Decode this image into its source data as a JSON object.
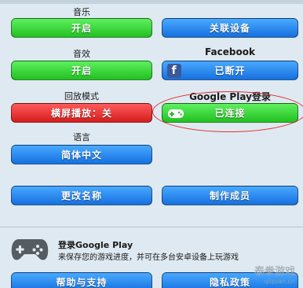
{
  "settings": {
    "music_label": "音乐",
    "music_button": "开启",
    "link_device_button": "关联设备",
    "sfx_label": "音效",
    "sfx_button": "开启",
    "facebook_label": "Facebook",
    "facebook_button": "已断开",
    "replay_label": "回放模式",
    "replay_button": "横屏播放：关",
    "gplay_label": "Google Play登录",
    "gplay_button": "已连接",
    "language_label": "语言",
    "language_button": "简体中文",
    "rename_button": "更改名称",
    "credits_button": "制作成员",
    "help_button": "帮助与支持",
    "privacy_button": "隐私政策"
  },
  "info": {
    "title": "登录Google Play",
    "desc": "来保存您的游戏进度，并可在多台安卓设备上玩游戏"
  },
  "watermark": {
    "text": "泰拳游戏",
    "sub": "qiquan.cn"
  },
  "colors": {
    "green": "#2ed12e",
    "blue": "#2088f0",
    "red": "#e52a2a",
    "facebook": "#3b5998",
    "annotation": "#e03030"
  }
}
